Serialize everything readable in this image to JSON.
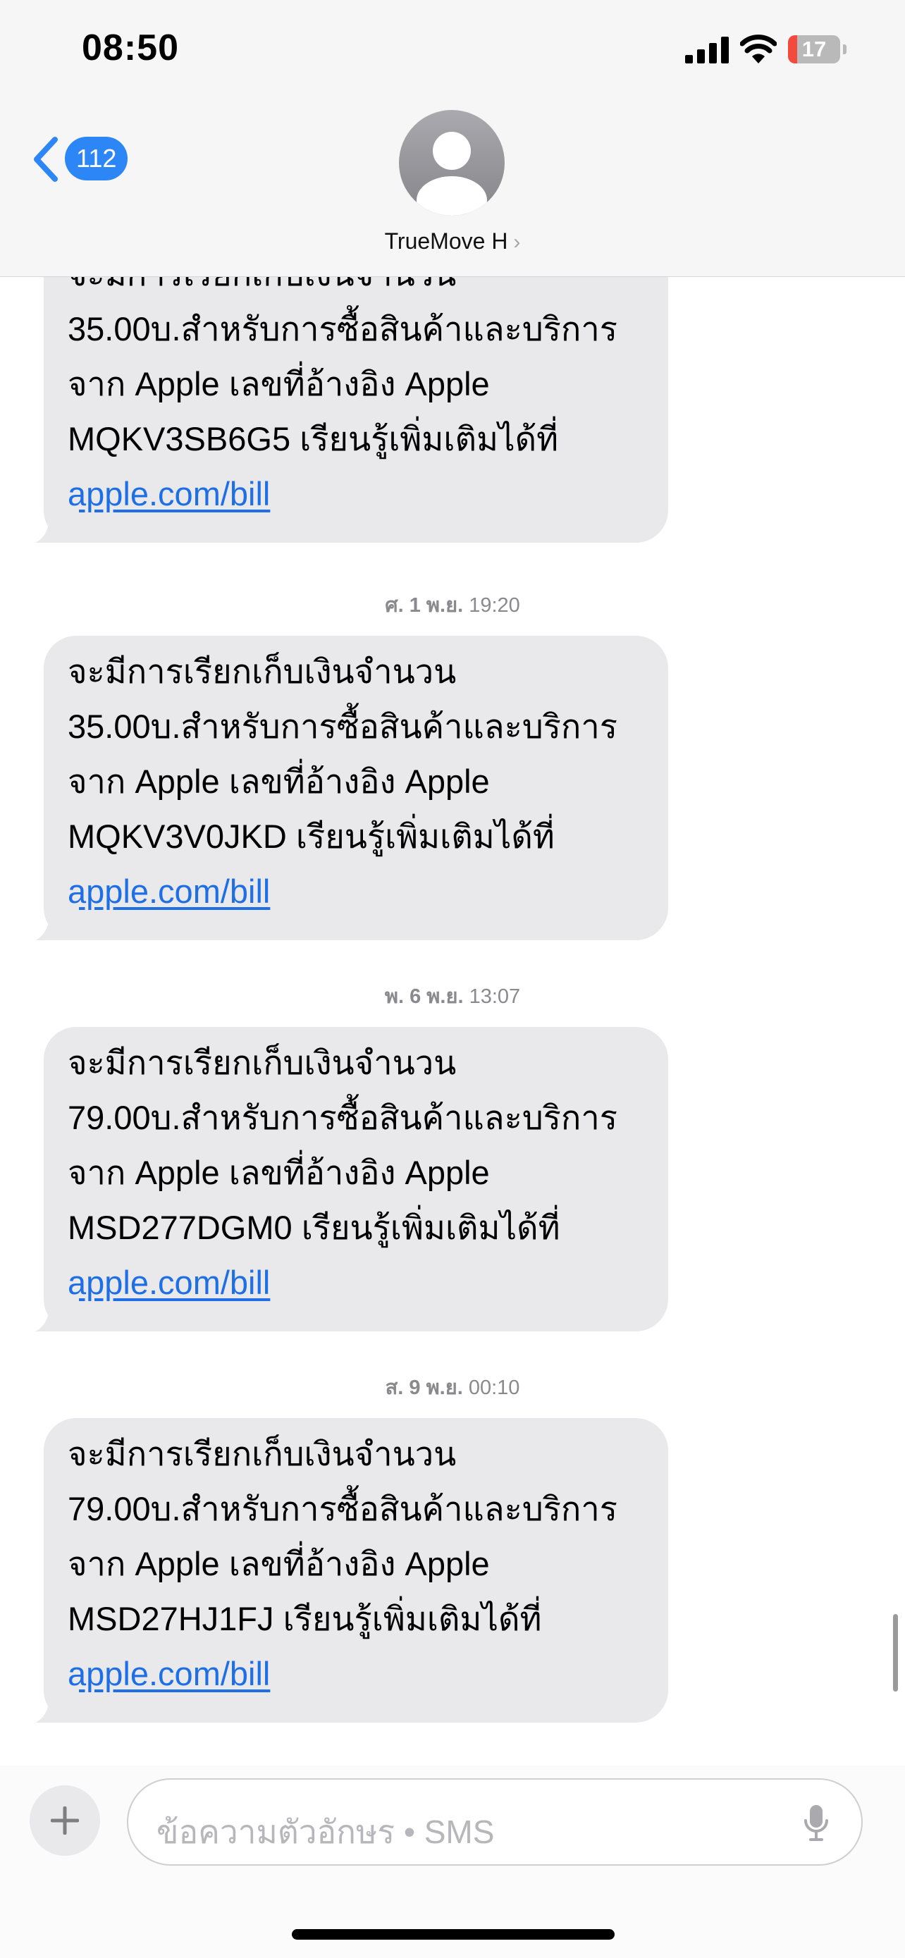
{
  "status_bar": {
    "time": "08:50",
    "battery_level": "17",
    "battery_fraction": 0.17,
    "battery_color": "#f24a3e"
  },
  "header": {
    "back_badge": "112",
    "contact_name": "TrueMove H",
    "contact_chevron": "›"
  },
  "messages": [
    {
      "lines": [
        "จะมีการเรียกเก็บเงินจำนวน",
        "35.00บ.สำหรับการซื้อสินค้าและบริการ",
        "จาก Apple เลขที่อ้างอิง Apple",
        "MQKV3SB6G5 เรียนรู้เพิ่มเติมได้ที่"
      ],
      "link": "apple.com/bill"
    },
    {
      "timestamp_day": "ศ. 1 พ.ย.",
      "timestamp_time": "19:20",
      "lines": [
        "จะมีการเรียกเก็บเงินจำนวน",
        "35.00บ.สำหรับการซื้อสินค้าและบริการ",
        "จาก Apple เลขที่อ้างอิง Apple",
        "MQKV3V0JKD เรียนรู้เพิ่มเติมได้ที่"
      ],
      "link": "apple.com/bill"
    },
    {
      "timestamp_day": "พ. 6 พ.ย.",
      "timestamp_time": "13:07",
      "lines": [
        "จะมีการเรียกเก็บเงินจำนวน",
        "79.00บ.สำหรับการซื้อสินค้าและบริการ",
        "จาก Apple เลขที่อ้างอิง Apple",
        "MSD277DGM0 เรียนรู้เพิ่มเติมได้ที่"
      ],
      "link": "apple.com/bill"
    },
    {
      "timestamp_day": "ส. 9 พ.ย.",
      "timestamp_time": "00:10",
      "lines": [
        "จะมีการเรียกเก็บเงินจำนวน",
        "79.00บ.สำหรับการซื้อสินค้าและบริการ",
        "จาก Apple เลขที่อ้างอิง Apple",
        "MSD27HJ1FJ เรียนรู้เพิ่มเติมได้ที่"
      ],
      "link": "apple.com/bill"
    }
  ],
  "composer": {
    "placeholder": "ข้อความตัวอักษร • SMS"
  },
  "icons": {
    "back": "chevron-left-icon",
    "avatar": "person-avatar-icon",
    "add": "plus-icon",
    "mic": "microphone-icon",
    "signal": "cellular-signal-icon",
    "wifi": "wifi-icon",
    "battery": "battery-icon"
  },
  "colors": {
    "accent": "#2c86f5",
    "bubble": "#e9e9eb",
    "link": "#1e6fe6",
    "timestamp": "#8a8a8e"
  }
}
